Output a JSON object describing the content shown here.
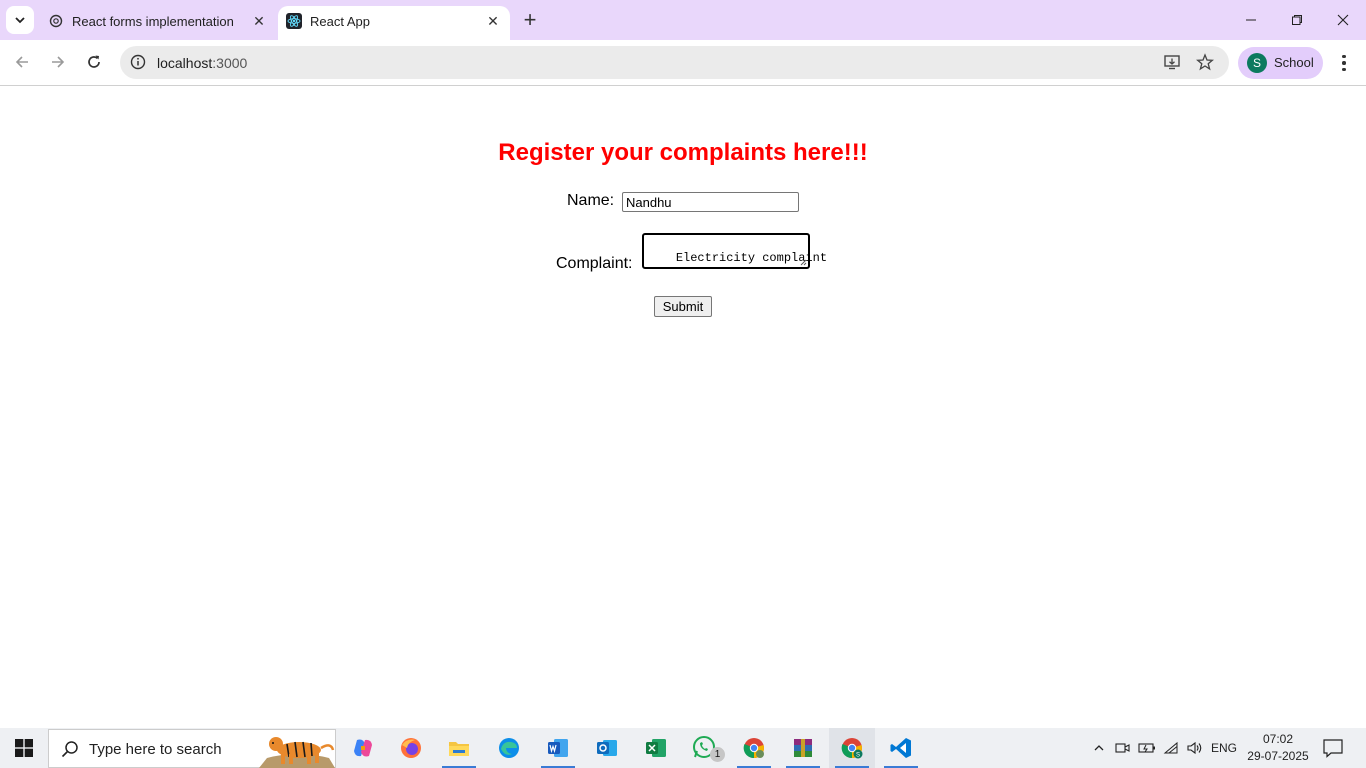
{
  "browser": {
    "tabs": [
      {
        "title": "React forms implementation",
        "icon": "chatgpt-icon",
        "active": false
      },
      {
        "title": "React App",
        "icon": "react-icon",
        "active": true
      }
    ],
    "url_host": "localhost",
    "url_port": ":3000",
    "profile_initial": "S",
    "profile_name": "School"
  },
  "form": {
    "heading": "Register your complaints here!!!",
    "name_label": "Name:",
    "name_value": "Nandhu",
    "complaint_label": "Complaint:",
    "complaint_value": "Electricity complaint",
    "submit_label": "Submit",
    "heading_color": "#ff0000"
  },
  "taskbar": {
    "search_placeholder": "Type here to search",
    "apps": [
      "copilot-icon",
      "firefox-icon",
      "file-explorer-icon",
      "edge-icon",
      "word-icon",
      "outlook-icon",
      "excel-icon",
      "whatsapp-icon",
      "chrome-icon",
      "winrar-icon",
      "chrome-profile-icon",
      "vscode-icon"
    ],
    "whatsapp_badge": "1",
    "language": "ENG",
    "time": "07:02",
    "date": "29-07-2025"
  }
}
